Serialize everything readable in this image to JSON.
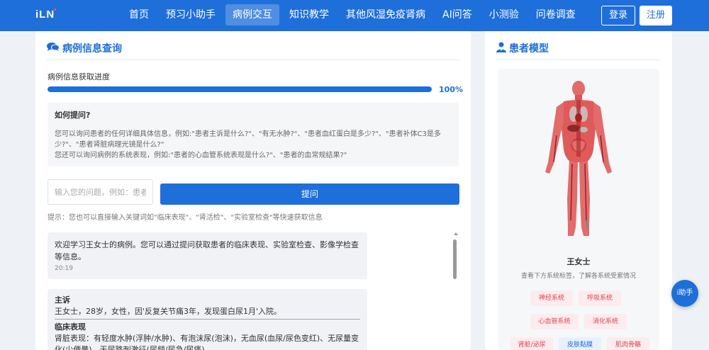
{
  "header": {
    "logo": "iLN",
    "nav": [
      {
        "label": "首页",
        "active": false
      },
      {
        "label": "预习小助手",
        "active": false
      },
      {
        "label": "病例交互",
        "active": true
      },
      {
        "label": "知识教学",
        "active": false
      },
      {
        "label": "其他风湿免疫肾病",
        "active": false
      },
      {
        "label": "AI问答",
        "active": false
      },
      {
        "label": "小测验",
        "active": false
      },
      {
        "label": "问卷调查",
        "active": false
      }
    ],
    "login_label": "登录",
    "register_label": "注册"
  },
  "case_query": {
    "title": "病例信息查询",
    "progress_label": "病例信息获取进度",
    "progress_percent": 100,
    "progress_text": "100%",
    "howto": {
      "title": "如何提问?",
      "line1": "您可以询问患者的任何详细具体信息，例如:\"患者主诉是什么?\"、\"有无水肿?\"、\"患者血红蛋白是多少?\"、\"患者补体C3是多少?\"、\"患者肾脏病理光镜是什么?\"",
      "line2": "您还可以询问病例的系统表现，例如:\"患者的心血管系统表现是什么?\"、\"患者的血常规结果?\""
    },
    "input_placeholder": "输入您的问题，例如：患者主诉是什么?",
    "ask_label": "提问",
    "tip": "提示：您也可以直接输入关键词如\"临床表现\"、\"肾活检\"、\"实验室检查\"等快速获取信息",
    "messages": [
      {
        "text": "欢迎学习王女士的病例。您可以通过提问获取患者的临床表现、实验室检查、影像学检查等信息。",
        "time": "20:19"
      }
    ],
    "reply": {
      "h1": "主诉",
      "t1": "王女士，28岁，女性，因'反复关节痛3年，发现蛋白尿1月'入院。",
      "h2": "临床表现",
      "t2": "肾脏表现：有轻度水肿(浮肿/水肿)、有泡沫尿(泡沫)，无血尿(血尿/尿色变红)、无尿量变化(少便量)、无尿路刺激征(尿频/尿急/尿痛)"
    }
  },
  "patient_model": {
    "title": "患者模型",
    "name": "王女士",
    "hint": "查看下方系统标签，了解各系统受累情况",
    "tags": [
      {
        "label": "神经系统",
        "color": "#e04050"
      },
      {
        "label": "呼吸系统",
        "color": "#e04050"
      },
      {
        "label": "心血管系统",
        "color": "#e04050"
      },
      {
        "label": "消化系统",
        "color": "#e04050"
      },
      {
        "label": "肾脏/泌尿",
        "color": "#e04050"
      },
      {
        "label": "皮肤黏膜",
        "color": "#1e6fd9"
      },
      {
        "label": "肌肉骨骼",
        "color": "#e04050"
      }
    ]
  },
  "float_button": "i助手"
}
